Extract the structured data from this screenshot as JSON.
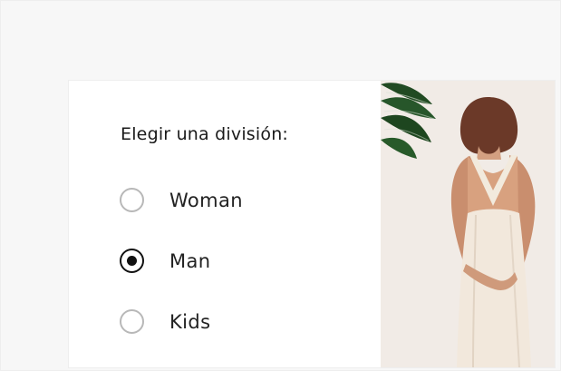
{
  "division_selector": {
    "title": "Elegir una división:",
    "options": [
      {
        "label": "Woman",
        "selected": false
      },
      {
        "label": "Man",
        "selected": true
      },
      {
        "label": "Kids",
        "selected": false
      }
    ]
  },
  "image": {
    "subject": "woman-in-cream-dress-with-plant"
  },
  "colors": {
    "page_background": "#f7f7f7",
    "card_background": "#ffffff",
    "image_background": "#efe7e2",
    "radio_selected": "#111111",
    "radio_unselected": "#b8b8b8",
    "text": "#1a1a1a"
  }
}
